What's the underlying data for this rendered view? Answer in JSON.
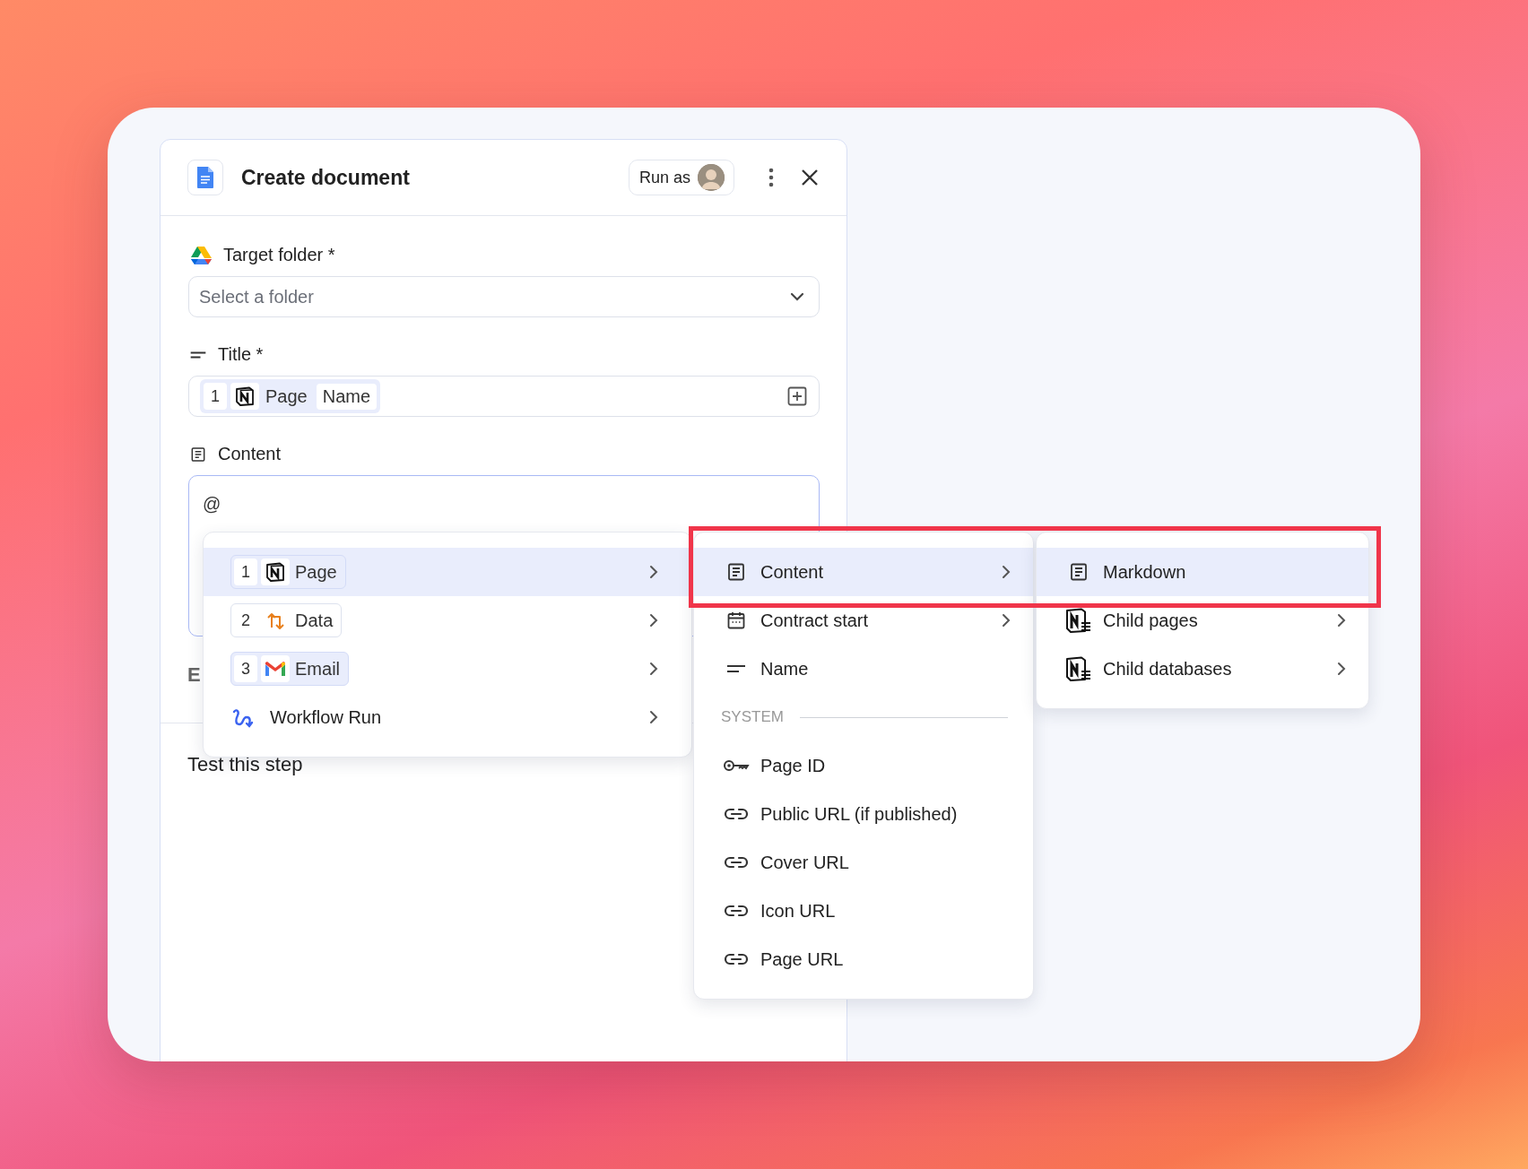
{
  "panel": {
    "title": "Create document",
    "run_as": "Run as"
  },
  "fields": [
    {
      "kind": "select",
      "label": "Target folder *",
      "placeholder": "Select a folder"
    },
    {
      "kind": "tokens",
      "label": "Title *",
      "token": {
        "step": "1",
        "parts": [
          "Page",
          "Name"
        ]
      }
    },
    {
      "kind": "editor",
      "label": "Content",
      "value": "@"
    }
  ],
  "hidden_label": "E",
  "test_heading": "Test this step",
  "menus": [
    {
      "items": [
        {
          "step": "1",
          "label": "Page",
          "tinted": true,
          "selected": true,
          "submenu": true
        },
        {
          "step": "2",
          "label": "Data",
          "tinted": false,
          "selected": false,
          "submenu": true
        },
        {
          "step": "3",
          "label": "Email",
          "tinted": true,
          "selected": false,
          "submenu": true
        },
        {
          "label": "Workflow Run",
          "selected": false,
          "submenu": true
        }
      ]
    },
    {
      "items": [
        {
          "kind": "item",
          "label": "Content",
          "selected": true,
          "submenu": true
        },
        {
          "kind": "item",
          "label": "Contract start",
          "selected": false,
          "submenu": true
        },
        {
          "kind": "item",
          "label": "Name",
          "selected": false,
          "submenu": false
        },
        {
          "kind": "section",
          "label": "SYSTEM"
        },
        {
          "kind": "item",
          "label": "Page ID",
          "selected": false,
          "submenu": false
        },
        {
          "kind": "item",
          "label": "Public URL (if published)",
          "selected": false,
          "submenu": false
        },
        {
          "kind": "item",
          "label": "Cover URL",
          "selected": false,
          "submenu": false
        },
        {
          "kind": "item",
          "label": "Icon URL",
          "selected": false,
          "submenu": false
        },
        {
          "kind": "item",
          "label": "Page URL",
          "selected": false,
          "submenu": false
        }
      ]
    },
    {
      "items": [
        {
          "kind": "item",
          "label": "Markdown",
          "selected": true,
          "submenu": false
        },
        {
          "kind": "item",
          "label": "Child pages",
          "selected": false,
          "submenu": true
        },
        {
          "kind": "item",
          "label": "Child databases",
          "selected": false,
          "submenu": true
        }
      ]
    }
  ]
}
